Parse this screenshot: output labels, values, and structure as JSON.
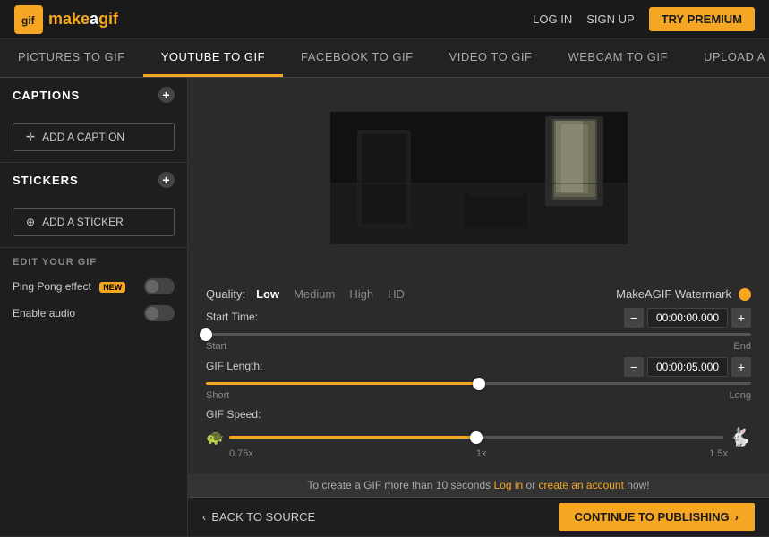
{
  "header": {
    "logo_icon": "gif",
    "logo_text_make": "make",
    "logo_text_a": "a",
    "logo_text_gif": "gif",
    "nav": {
      "login": "LOG IN",
      "signup": "SIGN UP",
      "premium": "TRY PREMIUM"
    }
  },
  "tabs": [
    {
      "id": "pictures",
      "label": "PICTURES TO GIF",
      "active": false
    },
    {
      "id": "youtube",
      "label": "YOUTUBE TO GIF",
      "active": true
    },
    {
      "id": "facebook",
      "label": "FACEBOOK TO GIF",
      "active": false
    },
    {
      "id": "video",
      "label": "VIDEO TO GIF",
      "active": false
    },
    {
      "id": "webcam",
      "label": "WEBCAM TO GIF",
      "active": false
    },
    {
      "id": "upload",
      "label": "UPLOAD A GIF",
      "active": false
    }
  ],
  "sidebar": {
    "captions_label": "CAPTIONS",
    "add_caption_label": "ADD A CAPTION",
    "stickers_label": "STICKERS",
    "add_sticker_label": "ADD A STICKER",
    "edit_section_label": "EDIT YOUR GIF",
    "ping_pong_label": "Ping Pong effect",
    "ping_pong_badge": "NEW",
    "enable_audio_label": "Enable audio"
  },
  "controls": {
    "quality": {
      "label": "Quality:",
      "options": [
        "Low",
        "Medium",
        "High",
        "HD"
      ],
      "active": "Low"
    },
    "watermark": {
      "label": "MakeAGIF Watermark"
    },
    "start_time": {
      "label": "Start Time:",
      "value": "00:00:00.000",
      "slider_start_label": "Start",
      "slider_end_label": "End",
      "slider_position_pct": 0
    },
    "gif_length": {
      "label": "GIF Length:",
      "value": "00:00:05.000",
      "slider_start_label": "Short",
      "slider_end_label": "Long",
      "slider_position_pct": 50
    },
    "gif_speed": {
      "label": "GIF Speed:",
      "speed_labels": [
        "0.75x",
        "1x",
        "1.5x"
      ],
      "slider_position_pct": 50
    }
  },
  "info_bar": {
    "text_before": "To create a GIF more than 10 seconds ",
    "link1": "Log in",
    "text_mid": " or ",
    "link2": "create an account",
    "text_after": " now!"
  },
  "footer": {
    "back_label": "BACK TO SOURCE",
    "continue_label": "CONTINUE TO PUBLISHING"
  }
}
